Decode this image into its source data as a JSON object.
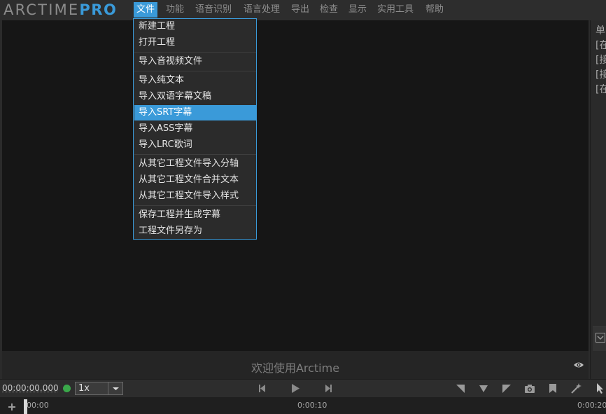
{
  "app": {
    "logo_main": "ARCTIME",
    "logo_accent": "PRO"
  },
  "menubar": {
    "items": [
      "文件",
      "功能",
      "语音识别",
      "语言处理",
      "导出",
      "检查",
      "显示",
      "实用工具",
      "帮助"
    ]
  },
  "file_menu": {
    "items": [
      "新建工程",
      "打开工程",
      "导入音视频文件",
      "导入纯文本",
      "导入双语字幕文稿",
      "导入SRT字幕",
      "导入ASS字幕",
      "导入LRC歌词",
      "从其它工程文件导入分轴",
      "从其它工程文件合并文本",
      "从其它工程文件导入样式",
      "保存工程并生成字幕",
      "工程文件另存为"
    ],
    "highlighted": "导入SRT字幕"
  },
  "preview": {
    "welcome_text": "欢迎使用Arctime"
  },
  "right_panel": {
    "lines": [
      "单",
      "[在",
      "[接",
      "[接",
      "[在"
    ]
  },
  "transport": {
    "timecode": "00:00:00.000",
    "speed": "1x",
    "status_color": "#3aa84a"
  },
  "timeline": {
    "ticks": [
      "00:00",
      "0:00:10",
      "0:00:20"
    ]
  },
  "theme": {
    "accent": "#3a9ad9",
    "background": "#2b2b2b",
    "preview_bg": "#161616"
  }
}
